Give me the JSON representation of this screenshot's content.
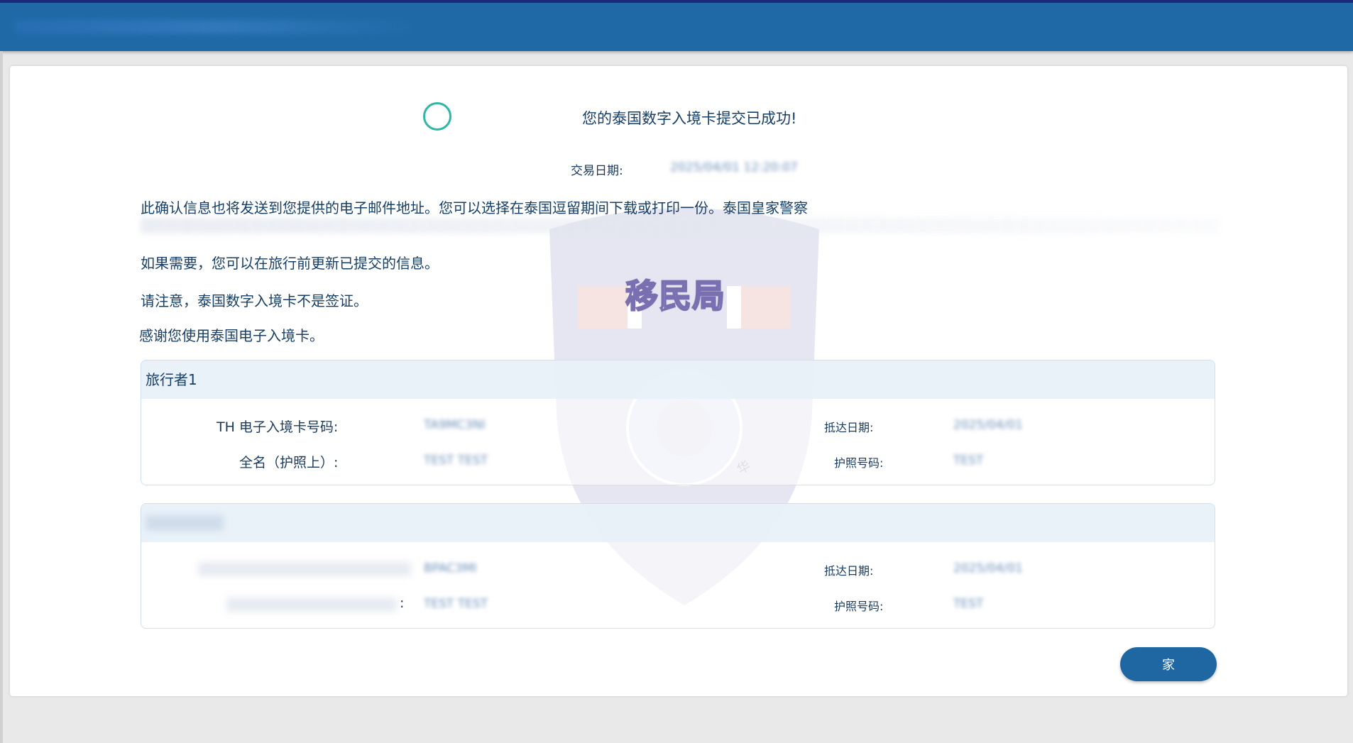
{
  "header": {
    "title_blurred": ""
  },
  "confirmation": {
    "title": "您的泰国数字入境卡提交已成功!",
    "transaction_date_label": "交易日期:",
    "transaction_date_value": "2025/04/01 12:20:07",
    "paragraph_email": "此确认信息也将发送到您提供的电子邮件地址。您可以选择在泰国逗留期间下载或打印一份。泰国皇家警察",
    "paragraph_update": "如果需要，您可以在旅行前更新已提交的信息。",
    "paragraph_visa": "请注意，泰国数字入境卡不是签证。",
    "paragraph_thanks": "感谢您使用泰国电子入境卡。"
  },
  "watermark": {
    "text": "移民局",
    "small_text": "华"
  },
  "travelers": [
    {
      "heading": "旅行者1",
      "card_no_label": "TH 电子入境卡号码:",
      "card_no_value": "TA9MC3NI",
      "name_label": "全名（护照上）:",
      "name_value": "TEST TEST",
      "arrival_label": "抵达日期:",
      "arrival_value": "2025/04/01",
      "passport_label": "护照号码:",
      "passport_value": "TEST"
    },
    {
      "heading": "",
      "card_no_label": "",
      "card_no_value": "BPAC3MI",
      "name_label": ":",
      "name_value": "TEST TEST",
      "arrival_label": "抵达日期:",
      "arrival_value": "2025/04/01",
      "passport_label": "护照号码:",
      "passport_value": "TEST"
    }
  ],
  "actions": {
    "home_label": "家"
  },
  "colors": {
    "header_blue": "#1f6aa6",
    "accent_teal": "#2fb7a6",
    "button_blue": "#1f67a3",
    "text_navy": "#173f66"
  }
}
